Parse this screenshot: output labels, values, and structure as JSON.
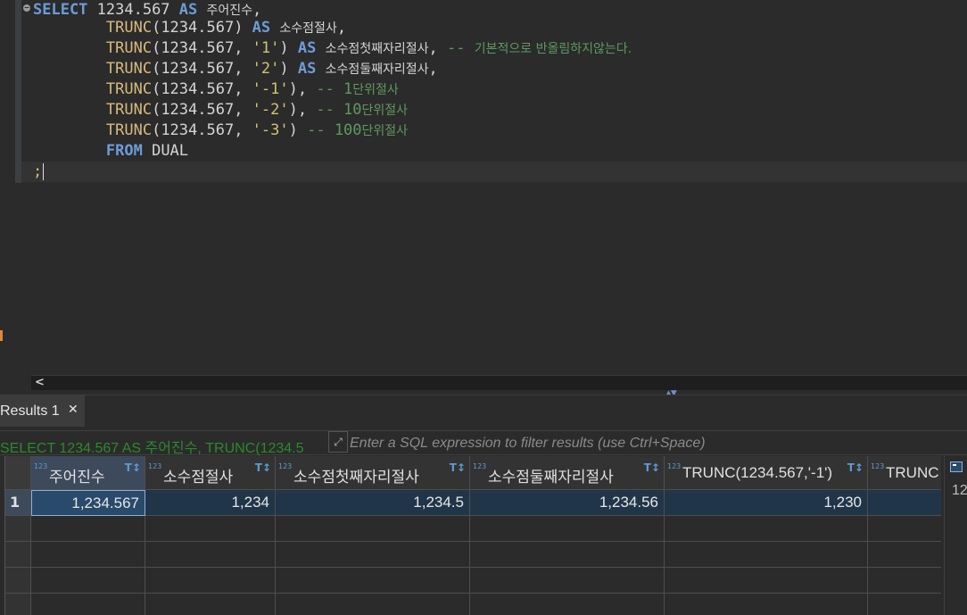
{
  "editor": {
    "lines": [
      {
        "parts": [
          {
            "t": "SELECT",
            "c": "kw"
          },
          {
            "t": " 1234.567 ",
            "c": ""
          },
          {
            "t": "AS",
            "c": "kw"
          },
          {
            "t": " ",
            "c": ""
          },
          {
            "t": "주어진수",
            "c": "kr"
          },
          {
            "t": ",",
            "c": ""
          }
        ]
      },
      {
        "parts": [
          {
            "t": "        ",
            "c": ""
          },
          {
            "t": "TRUNC",
            "c": "fn"
          },
          {
            "t": "(1234.567) ",
            "c": ""
          },
          {
            "t": "AS",
            "c": "kw"
          },
          {
            "t": " ",
            "c": ""
          },
          {
            "t": "소수점절사",
            "c": "kr"
          },
          {
            "t": ",",
            "c": ""
          }
        ]
      },
      {
        "parts": [
          {
            "t": "        ",
            "c": ""
          },
          {
            "t": "TRUNC",
            "c": "fn"
          },
          {
            "t": "(1234.567, ",
            "c": ""
          },
          {
            "t": "'1'",
            "c": "str"
          },
          {
            "t": ") ",
            "c": ""
          },
          {
            "t": "AS",
            "c": "kw"
          },
          {
            "t": " ",
            "c": ""
          },
          {
            "t": "소수점첫째자리절사",
            "c": "kr"
          },
          {
            "t": ", ",
            "c": ""
          },
          {
            "t": "-- ",
            "c": "cm"
          },
          {
            "t": "기본적으로 반올림하지않는다.",
            "c": "cmkr"
          }
        ]
      },
      {
        "parts": [
          {
            "t": "        ",
            "c": ""
          },
          {
            "t": "TRUNC",
            "c": "fn"
          },
          {
            "t": "(1234.567, ",
            "c": ""
          },
          {
            "t": "'2'",
            "c": "str"
          },
          {
            "t": ") ",
            "c": ""
          },
          {
            "t": "AS",
            "c": "kw"
          },
          {
            "t": " ",
            "c": ""
          },
          {
            "t": "소수점둘째자리절사",
            "c": "kr"
          },
          {
            "t": ",",
            "c": ""
          }
        ]
      },
      {
        "parts": [
          {
            "t": "        ",
            "c": ""
          },
          {
            "t": "TRUNC",
            "c": "fn"
          },
          {
            "t": "(1234.567, ",
            "c": ""
          },
          {
            "t": "'-1'",
            "c": "str"
          },
          {
            "t": "), ",
            "c": ""
          },
          {
            "t": "-- 1",
            "c": "cm"
          },
          {
            "t": "단위절사",
            "c": "cmkr"
          }
        ]
      },
      {
        "parts": [
          {
            "t": "        ",
            "c": ""
          },
          {
            "t": "TRUNC",
            "c": "fn"
          },
          {
            "t": "(1234.567, ",
            "c": ""
          },
          {
            "t": "'-2'",
            "c": "str"
          },
          {
            "t": "), ",
            "c": ""
          },
          {
            "t": "-- 10",
            "c": "cm"
          },
          {
            "t": "단위절사",
            "c": "cmkr"
          }
        ]
      },
      {
        "parts": [
          {
            "t": "        ",
            "c": ""
          },
          {
            "t": "TRUNC",
            "c": "fn"
          },
          {
            "t": "(1234.567, ",
            "c": ""
          },
          {
            "t": "'-3'",
            "c": "str"
          },
          {
            "t": ") ",
            "c": ""
          },
          {
            "t": "-- 100",
            "c": "cm"
          },
          {
            "t": "단위절사",
            "c": "cmkr"
          }
        ]
      },
      {
        "parts": [
          {
            "t": "        ",
            "c": ""
          },
          {
            "t": "FROM",
            "c": "kw"
          },
          {
            "t": " DUAL",
            "c": ""
          }
        ]
      },
      {
        "parts": [
          {
            "t": ";",
            "c": "semi"
          }
        ],
        "current": true
      }
    ]
  },
  "results_tab": {
    "label": "Results 1",
    "close": "✕"
  },
  "filter": {
    "query_text": "SELECT 1234.567 AS 주어진수, TRUNC(1234.5",
    "placeholder": "Enter a SQL expression to filter results (use Ctrl+Space)"
  },
  "grid": {
    "type_badge": "123",
    "columns": [
      "주어진수",
      "소수점절사",
      "소수점첫째자리절사",
      "소수점둘째자리절사",
      "TRUNC(1234.567,'-1')",
      "TRUNC"
    ],
    "rows": [
      {
        "num": "1",
        "cells": [
          "1,234.567",
          "1,234",
          "1,234.5",
          "1,234.56",
          "1,230",
          ""
        ]
      }
    ],
    "empty_rows": 4
  },
  "side_panel": {
    "value": "12"
  }
}
